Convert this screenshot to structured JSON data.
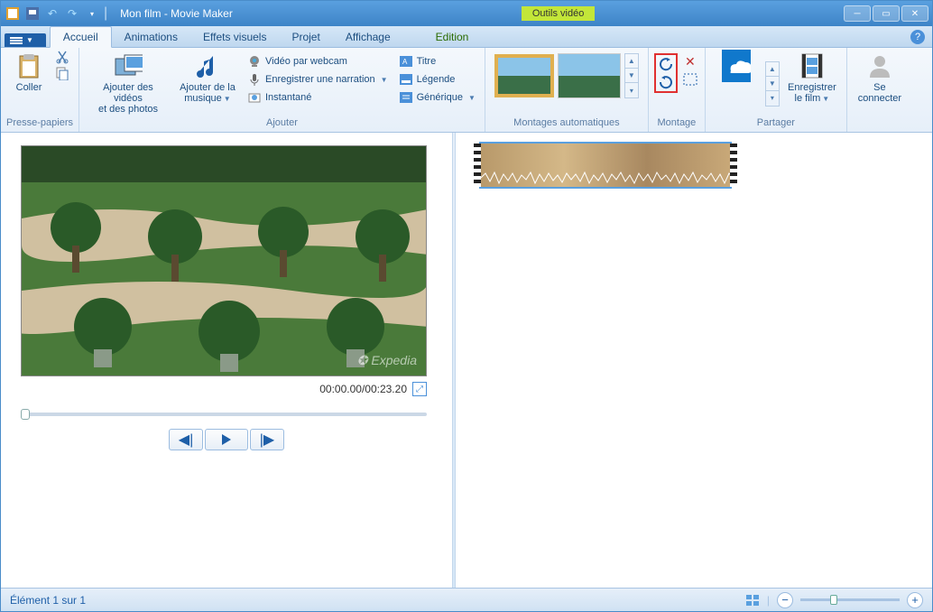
{
  "window": {
    "title": "Mon film - Movie Maker",
    "tool_tab": "Outils vidéo"
  },
  "tabs": {
    "file_has_dropdown": true,
    "accueil": "Accueil",
    "animations": "Animations",
    "effets": "Effets visuels",
    "projet": "Projet",
    "affichage": "Affichage",
    "edition": "Edition"
  },
  "ribbon": {
    "presse_papiers": {
      "label": "Presse-papiers",
      "coller": "Coller"
    },
    "ajouter": {
      "label": "Ajouter",
      "ajouter_videos": "Ajouter des vidéos\net des photos",
      "ajouter_musique": "Ajouter de la\nmusique",
      "webcam": "Vidéo par webcam",
      "narration": "Enregistrer une narration",
      "instantane": "Instantané",
      "titre": "Titre",
      "legende": "Légende",
      "generique": "Générique"
    },
    "montages_auto": {
      "label": "Montages automatiques"
    },
    "montage": {
      "label": "Montage"
    },
    "partager": {
      "label": "Partager",
      "enregistrer": "Enregistrer\nle film"
    },
    "connecter": {
      "label": "",
      "se_connecter": "Se\nconnecter"
    }
  },
  "player": {
    "time_display": "00:00.00/00:23.20",
    "watermark": "✪ Expedia"
  },
  "status": {
    "element_text": "Élément 1 sur 1"
  }
}
